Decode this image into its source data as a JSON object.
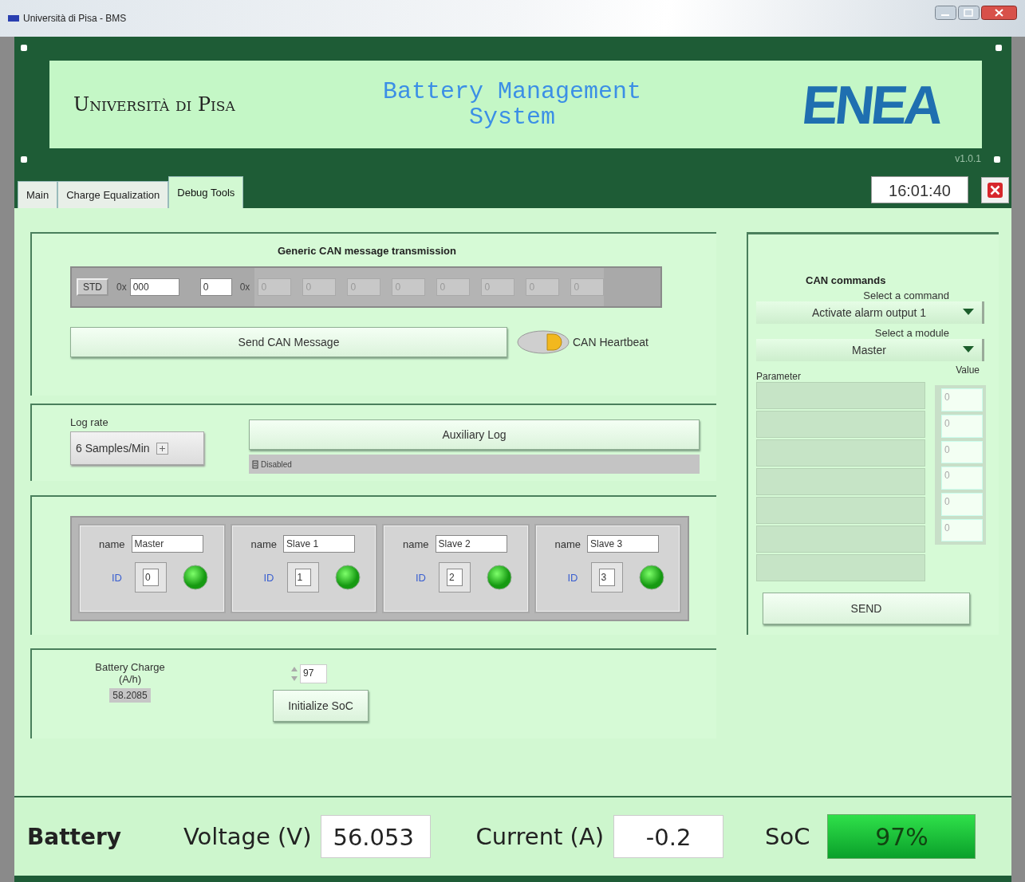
{
  "window": {
    "title": "Università di Pisa - BMS"
  },
  "header": {
    "university": "Università di Pisa",
    "title": "Battery Management System",
    "logo": "ENEA",
    "version": "v1.0.1"
  },
  "tabs": [
    {
      "label": "Main",
      "selected": false
    },
    {
      "label": "Charge Equalization",
      "selected": false
    },
    {
      "label": "Debug Tools",
      "selected": true
    }
  ],
  "clock": "16:01:40",
  "can_message": {
    "title": "Generic CAN message transmission",
    "frame_type": "STD",
    "id_prefix": "0x",
    "id": "000",
    "length": "0",
    "data_prefix": "0x",
    "data": [
      "0",
      "0",
      "0",
      "0",
      "0",
      "0",
      "0",
      "0"
    ],
    "send_button": "Send CAN Message",
    "heartbeat": {
      "label": "CAN Heartbeat",
      "on": true
    }
  },
  "log": {
    "label": "Log rate",
    "rate": "6 Samples/Min",
    "button": "Auxiliary Log",
    "status": "Disabled"
  },
  "modules": [
    {
      "name_label": "name",
      "name": "Master",
      "id_label": "ID",
      "id": "0",
      "online": true
    },
    {
      "name_label": "name",
      "name": "Slave 1",
      "id_label": "ID",
      "id": "1",
      "online": true
    },
    {
      "name_label": "name",
      "name": "Slave 2",
      "id_label": "ID",
      "id": "2",
      "online": true
    },
    {
      "name_label": "name",
      "name": "Slave 3",
      "id_label": "ID",
      "id": "3",
      "online": true
    }
  ],
  "soc_init": {
    "charge_label": "Battery Charge (A/h)",
    "charge": "58.2085",
    "soc": "97",
    "button": "Initialize SoC"
  },
  "can_commands": {
    "title": "CAN commands",
    "command_label": "Select a command",
    "command": "Activate alarm output 1",
    "module_label": "Select a module",
    "module": "Master",
    "parameter_header": "Parameter",
    "value_header": "Value",
    "values": [
      "0",
      "0",
      "0",
      "0",
      "0",
      "0"
    ],
    "send_button": "SEND"
  },
  "status_bar": {
    "title": "Battery",
    "voltage_label": "Voltage (V)",
    "voltage": "56.053",
    "current_label": "Current (A)",
    "current": "-0.2",
    "soc_label": "SoC",
    "soc": "97%"
  }
}
